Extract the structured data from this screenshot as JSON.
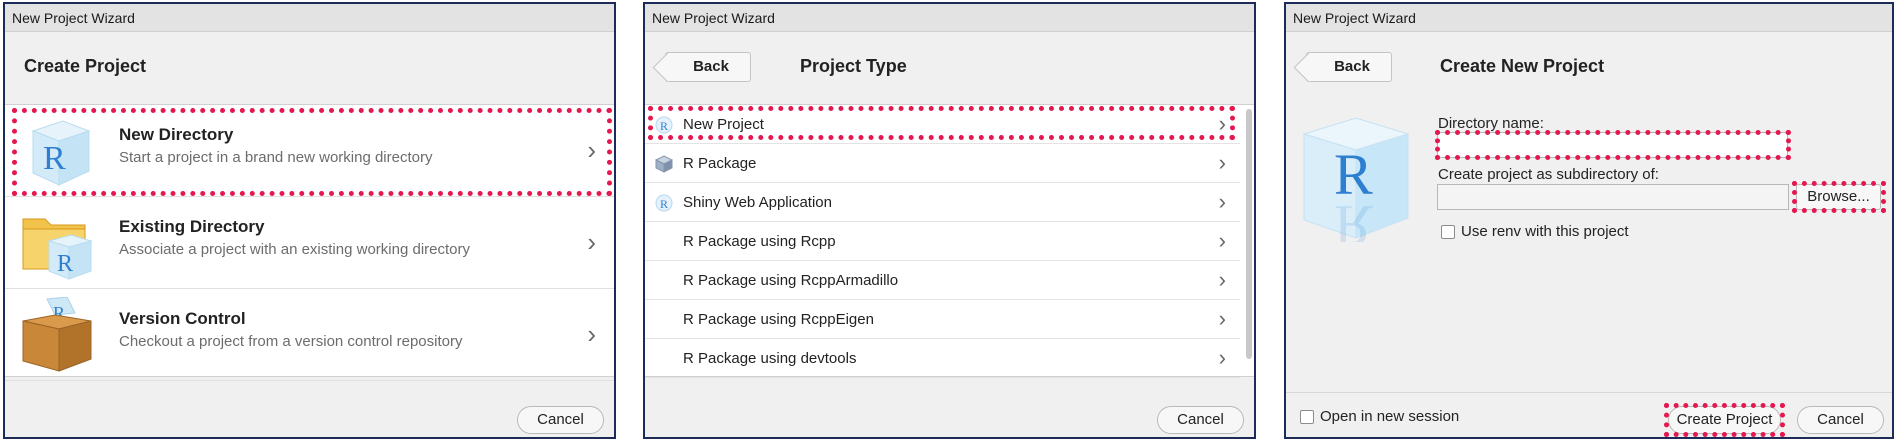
{
  "panel1": {
    "window_title": "New Project Wizard",
    "header": "Create Project",
    "choices": [
      {
        "title": "New Directory",
        "desc": "Start a project in a brand new working directory",
        "icon": "r-cube-icon"
      },
      {
        "title": "Existing Directory",
        "desc": "Associate a project with an existing working directory",
        "icon": "folder-r-icon"
      },
      {
        "title": "Version Control",
        "desc": "Checkout a project from a version control repository",
        "icon": "box-icon"
      }
    ],
    "cancel_label": "Cancel"
  },
  "panel2": {
    "window_title": "New Project Wizard",
    "header": "Project Type",
    "back_label": "Back",
    "items": [
      {
        "label": "New Project",
        "icon": "r-icon"
      },
      {
        "label": "R Package",
        "icon": "package-icon"
      },
      {
        "label": "Shiny Web Application",
        "icon": "r-icon"
      },
      {
        "label": "R Package using Rcpp",
        "icon": ""
      },
      {
        "label": "R Package using RcppArmadillo",
        "icon": ""
      },
      {
        "label": "R Package using RcppEigen",
        "icon": ""
      },
      {
        "label": "R Package using devtools",
        "icon": ""
      }
    ],
    "cancel_label": "Cancel"
  },
  "panel3": {
    "window_title": "New Project Wizard",
    "header": "Create New Project",
    "back_label": "Back",
    "dir_name_label": "Directory name:",
    "dir_name_value": "",
    "subdir_label": "Create project as subdirectory of:",
    "subdir_value": "",
    "browse_label": "Browse...",
    "renv_label": "Use renv with this project",
    "new_session_label": "Open in new session",
    "create_label": "Create Project",
    "cancel_label": "Cancel"
  },
  "colors": {
    "highlight": "#e4174f",
    "border": "#1c2b57",
    "r_blue": "#2f7fd0"
  }
}
